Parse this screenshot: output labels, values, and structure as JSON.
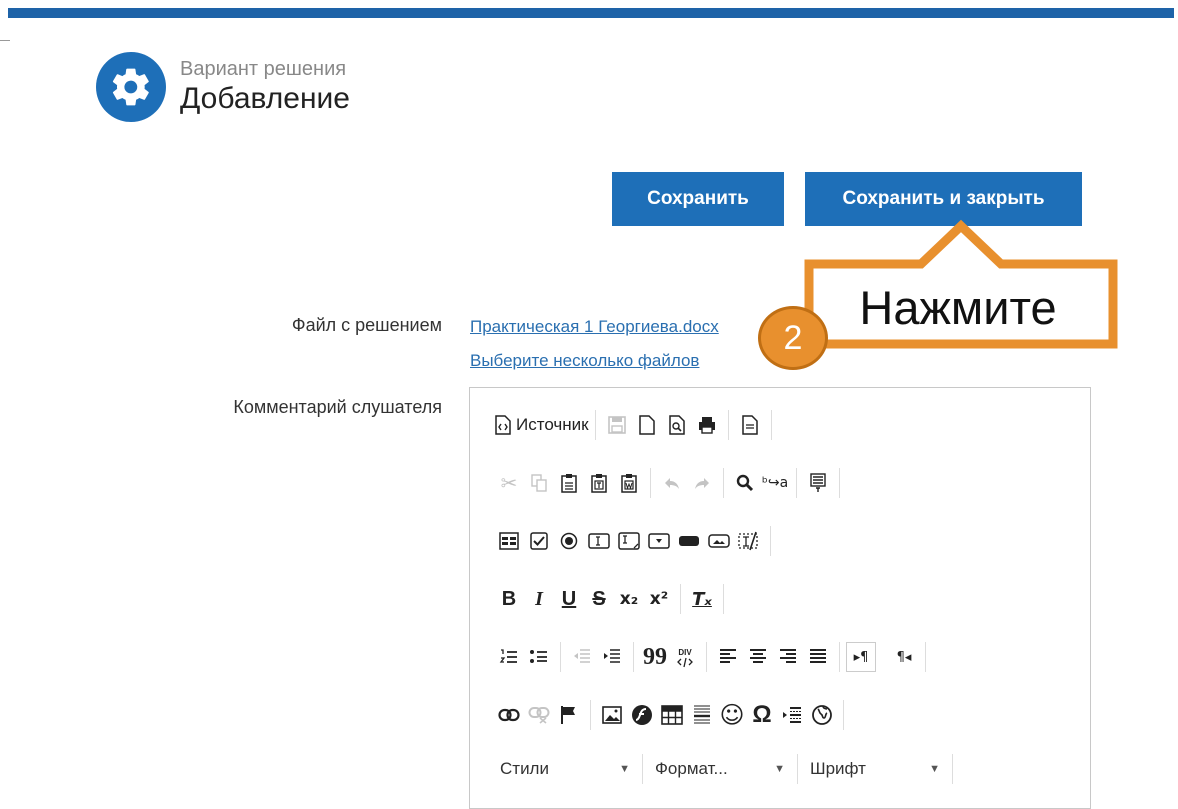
{
  "header": {
    "subtitle": "Вариант решения",
    "title": "Добавление"
  },
  "buttons": {
    "save": "Сохранить",
    "save_close": "Сохранить и закрыть"
  },
  "callout": {
    "text": "Нажмите",
    "step": "2"
  },
  "form": {
    "file_label": "Файл с решением",
    "file_link": "Практическая 1 Георгиева.docx",
    "choose_files": "Выберите несколько файлов",
    "comment_label": "Комментарий слушателя"
  },
  "editor": {
    "source_label": "Источник",
    "styles": "Стили",
    "format": "Формат...",
    "font": "Шрифт",
    "text_icons": {
      "bold": "B",
      "italic": "I",
      "underline": "U",
      "strike": "S",
      "subscript": "x₂",
      "superscript": "x²",
      "remove_format": "Tₓ",
      "quote": "99",
      "smiley": "☺",
      "omega": "Ω",
      "ltr": "▸¶",
      "rtl": "¶◂",
      "find_replace": "ᵇ↪a"
    }
  },
  "colors": {
    "accent": "#1e6fb8",
    "top_bar": "#1e63a8",
    "callout_orange": "#e8902e",
    "link": "#2a6fb0"
  }
}
